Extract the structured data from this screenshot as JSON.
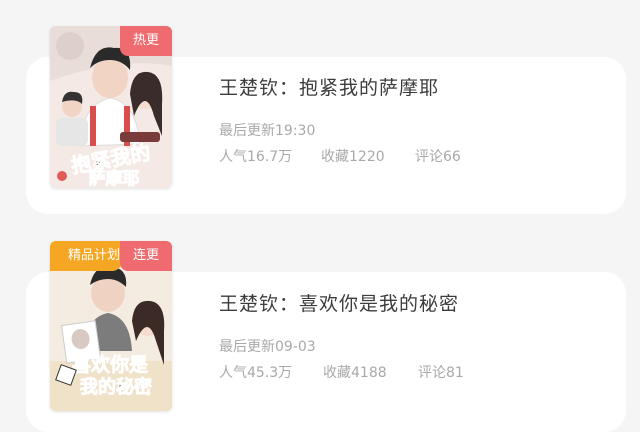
{
  "items": [
    {
      "badge": "热更",
      "cover_title": "抱紧我的萨摩耶",
      "title": "王楚钦：抱紧我的萨摩耶",
      "updated": "最后更新19:30",
      "popularity": "人气16.7万",
      "favorites": "收藏1220",
      "comments": "评论66"
    },
    {
      "plan_badge": "精品计划",
      "badge": "连更",
      "cover_title": "喜欢你是我的秘密",
      "title": "王楚钦：喜欢你是我的秘密",
      "updated": "最后更新09-03",
      "popularity": "人气45.3万",
      "favorites": "收藏4188",
      "comments": "评论81"
    }
  ],
  "colors": {
    "hot_badge": "#ef6b6f",
    "plan_badge": "#f5a623",
    "title": "#3c3c3c",
    "meta": "#a9a9a9"
  }
}
